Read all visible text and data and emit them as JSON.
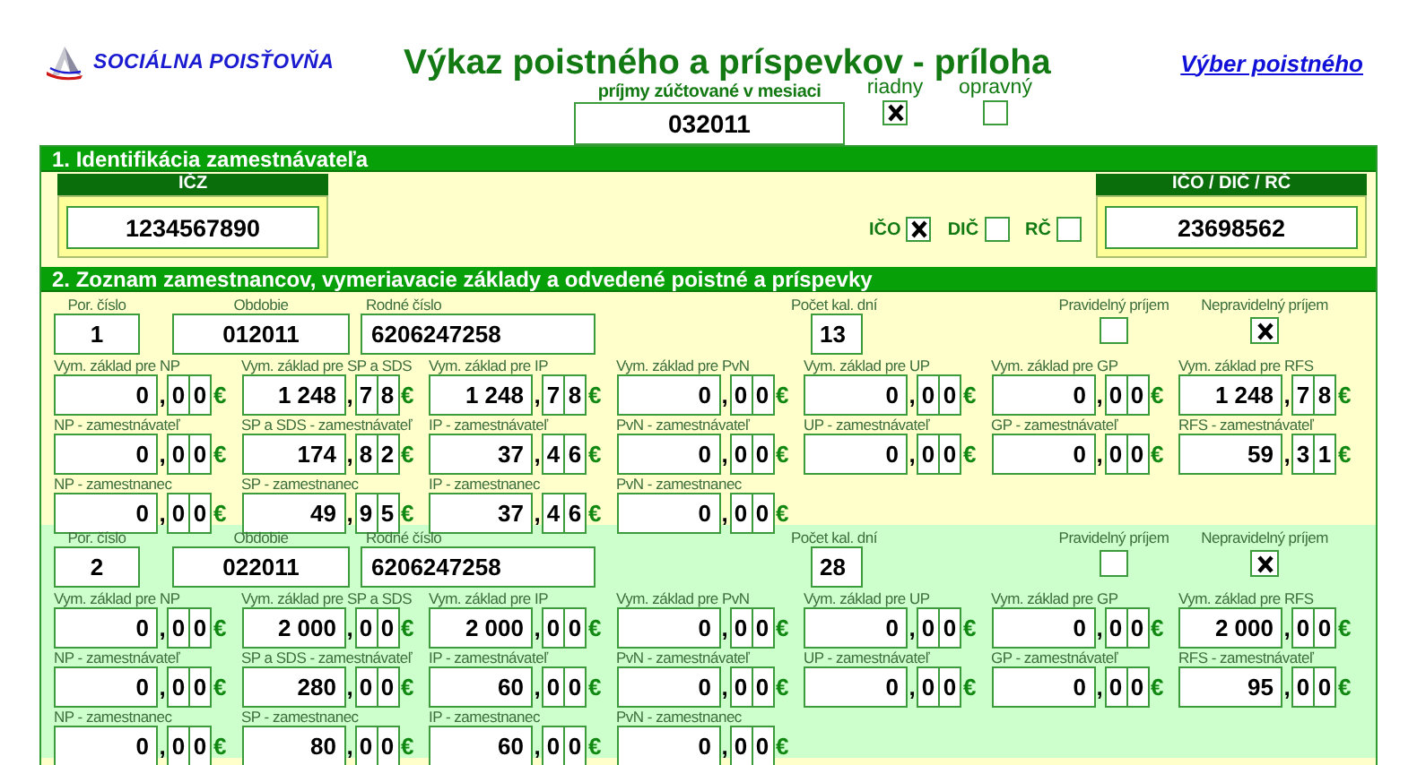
{
  "logo": {
    "text": "SOCIÁLNA POISŤOVŇA"
  },
  "title": "Výkaz poistného a príspevkov - príloha",
  "link": "Výber poistného",
  "month": {
    "label": "príjmy zúčtované v mesiaci",
    "value": "032011"
  },
  "report_type": [
    {
      "label": "riadny",
      "checked": true
    },
    {
      "label": "opravný",
      "checked": false
    }
  ],
  "employer": {
    "heading": "1. Identifikácia zamestnávateľa",
    "icz": {
      "label": "IČZ",
      "value": "1234567890"
    },
    "id_types": [
      {
        "label": "IČO",
        "checked": true
      },
      {
        "label": "DIČ",
        "checked": false
      },
      {
        "label": "RČ",
        "checked": false
      }
    ],
    "id": {
      "label": "IČO / DIČ / RČ",
      "value": "23698562"
    }
  },
  "employees_section": {
    "heading": "2. Zoznam zamestnancov, vymeriavacie základy a odvedené poistné a príspevky",
    "employees": [
      {
        "number_label": "Por. číslo",
        "number": "1",
        "period_label": "Obdobie",
        "period": "012011",
        "birth_label": "Rodné číslo",
        "birth_number": "6206247258",
        "days_label": "Počet kal. dní",
        "days": "13",
        "income": [
          {
            "label": "Pravidelný príjem",
            "checked": false
          },
          {
            "label": "Nepravidelný príjem",
            "checked": true
          }
        ],
        "amount_rows": [
          [
            {
              "label": "Vym. základ pre NP",
              "whole": "0",
              "sep": ",",
              "decimals": [
                "0",
                "0"
              ],
              "currency": "€"
            },
            {
              "label": "Vym. základ pre SP a SDS",
              "whole": "1 248",
              "sep": ",",
              "decimals": [
                "7",
                "8"
              ],
              "currency": "€"
            },
            {
              "label": "Vym. základ pre IP",
              "whole": "1 248",
              "sep": ",",
              "decimals": [
                "7",
                "8"
              ],
              "currency": "€"
            },
            {
              "label": "Vym. základ pre PvN",
              "whole": "0",
              "sep": ",",
              "decimals": [
                "0",
                "0"
              ],
              "currency": "€"
            },
            {
              "label": "Vym. základ pre UP",
              "whole": "0",
              "sep": ",",
              "decimals": [
                "0",
                "0"
              ],
              "currency": "€"
            },
            {
              "label": "Vym. základ pre GP",
              "whole": "0",
              "sep": ",",
              "decimals": [
                "0",
                "0"
              ],
              "currency": "€"
            },
            {
              "label": "Vym. základ pre RFS",
              "whole": "1 248",
              "sep": ",",
              "decimals": [
                "7",
                "8"
              ],
              "currency": "€"
            }
          ],
          [
            {
              "label": "NP - zamestnávateľ",
              "whole": "0",
              "sep": ",",
              "decimals": [
                "0",
                "0"
              ],
              "currency": "€"
            },
            {
              "label": "SP a SDS - zamestnávateľ",
              "whole": "174",
              "sep": ",",
              "decimals": [
                "8",
                "2"
              ],
              "currency": "€"
            },
            {
              "label": "IP - zamestnávateľ",
              "whole": "37",
              "sep": ",",
              "decimals": [
                "4",
                "6"
              ],
              "currency": "€"
            },
            {
              "label": "PvN - zamestnávateľ",
              "whole": "0",
              "sep": ",",
              "decimals": [
                "0",
                "0"
              ],
              "currency": "€"
            },
            {
              "label": "UP - zamestnávateľ",
              "whole": "0",
              "sep": ",",
              "decimals": [
                "0",
                "0"
              ],
              "currency": "€"
            },
            {
              "label": "GP - zamestnávateľ",
              "whole": "0",
              "sep": ",",
              "decimals": [
                "0",
                "0"
              ],
              "currency": "€"
            },
            {
              "label": "RFS - zamestnávateľ",
              "whole": "59",
              "sep": ",",
              "decimals": [
                "3",
                "1"
              ],
              "currency": "€"
            }
          ],
          [
            {
              "label": "NP - zamestnanec",
              "whole": "0",
              "sep": ",",
              "decimals": [
                "0",
                "0"
              ],
              "currency": "€"
            },
            {
              "label": "SP - zamestnanec",
              "whole": "49",
              "sep": ",",
              "decimals": [
                "9",
                "5"
              ],
              "currency": "€"
            },
            {
              "label": "IP - zamestnanec",
              "whole": "37",
              "sep": ",",
              "decimals": [
                "4",
                "6"
              ],
              "currency": "€"
            },
            {
              "label": "PvN - zamestnanec",
              "whole": "0",
              "sep": ",",
              "decimals": [
                "0",
                "0"
              ],
              "currency": "€"
            }
          ]
        ]
      },
      {
        "number_label": "Por. číslo",
        "number": "2",
        "period_label": "Obdobie",
        "period": "022011",
        "birth_label": "Rodné číslo",
        "birth_number": "6206247258",
        "days_label": "Počet kal. dní",
        "days": "28",
        "income": [
          {
            "label": "Pravidelný príjem",
            "checked": false
          },
          {
            "label": "Nepravidelný príjem",
            "checked": true
          }
        ],
        "amount_rows": [
          [
            {
              "label": "Vym. základ pre NP",
              "whole": "0",
              "sep": ",",
              "decimals": [
                "0",
                "0"
              ],
              "currency": "€"
            },
            {
              "label": "Vym. základ pre SP a SDS",
              "whole": "2 000",
              "sep": ",",
              "decimals": [
                "0",
                "0"
              ],
              "currency": "€"
            },
            {
              "label": "Vym. základ pre IP",
              "whole": "2 000",
              "sep": ",",
              "decimals": [
                "0",
                "0"
              ],
              "currency": "€"
            },
            {
              "label": "Vym. základ pre PvN",
              "whole": "0",
              "sep": ",",
              "decimals": [
                "0",
                "0"
              ],
              "currency": "€"
            },
            {
              "label": "Vym. základ pre UP",
              "whole": "0",
              "sep": ",",
              "decimals": [
                "0",
                "0"
              ],
              "currency": "€"
            },
            {
              "label": "Vym. základ pre GP",
              "whole": "0",
              "sep": ",",
              "decimals": [
                "0",
                "0"
              ],
              "currency": "€"
            },
            {
              "label": "Vym. základ pre RFS",
              "whole": "2 000",
              "sep": ",",
              "decimals": [
                "0",
                "0"
              ],
              "currency": "€"
            }
          ],
          [
            {
              "label": "NP - zamestnávateľ",
              "whole": "0",
              "sep": ",",
              "decimals": [
                "0",
                "0"
              ],
              "currency": "€"
            },
            {
              "label": "SP a SDS - zamestnávateľ",
              "whole": "280",
              "sep": ",",
              "decimals": [
                "0",
                "0"
              ],
              "currency": "€"
            },
            {
              "label": "IP - zamestnávateľ",
              "whole": "60",
              "sep": ",",
              "decimals": [
                "0",
                "0"
              ],
              "currency": "€"
            },
            {
              "label": "PvN - zamestnávateľ",
              "whole": "0",
              "sep": ",",
              "decimals": [
                "0",
                "0"
              ],
              "currency": "€"
            },
            {
              "label": "UP - zamestnávateľ",
              "whole": "0",
              "sep": ",",
              "decimals": [
                "0",
                "0"
              ],
              "currency": "€"
            },
            {
              "label": "GP - zamestnávateľ",
              "whole": "0",
              "sep": ",",
              "decimals": [
                "0",
                "0"
              ],
              "currency": "€"
            },
            {
              "label": "RFS - zamestnávateľ",
              "whole": "95",
              "sep": ",",
              "decimals": [
                "0",
                "0"
              ],
              "currency": "€"
            }
          ],
          [
            {
              "label": "NP - zamestnanec",
              "whole": "0",
              "sep": ",",
              "decimals": [
                "0",
                "0"
              ],
              "currency": "€"
            },
            {
              "label": "SP - zamestnanec",
              "whole": "80",
              "sep": ",",
              "decimals": [
                "0",
                "0"
              ],
              "currency": "€"
            },
            {
              "label": "IP - zamestnanec",
              "whole": "60",
              "sep": ",",
              "decimals": [
                "0",
                "0"
              ],
              "currency": "€"
            },
            {
              "label": "PvN - zamestnanec",
              "whole": "0",
              "sep": ",",
              "decimals": [
                "0",
                "0"
              ],
              "currency": "€"
            }
          ]
        ]
      }
    ]
  }
}
